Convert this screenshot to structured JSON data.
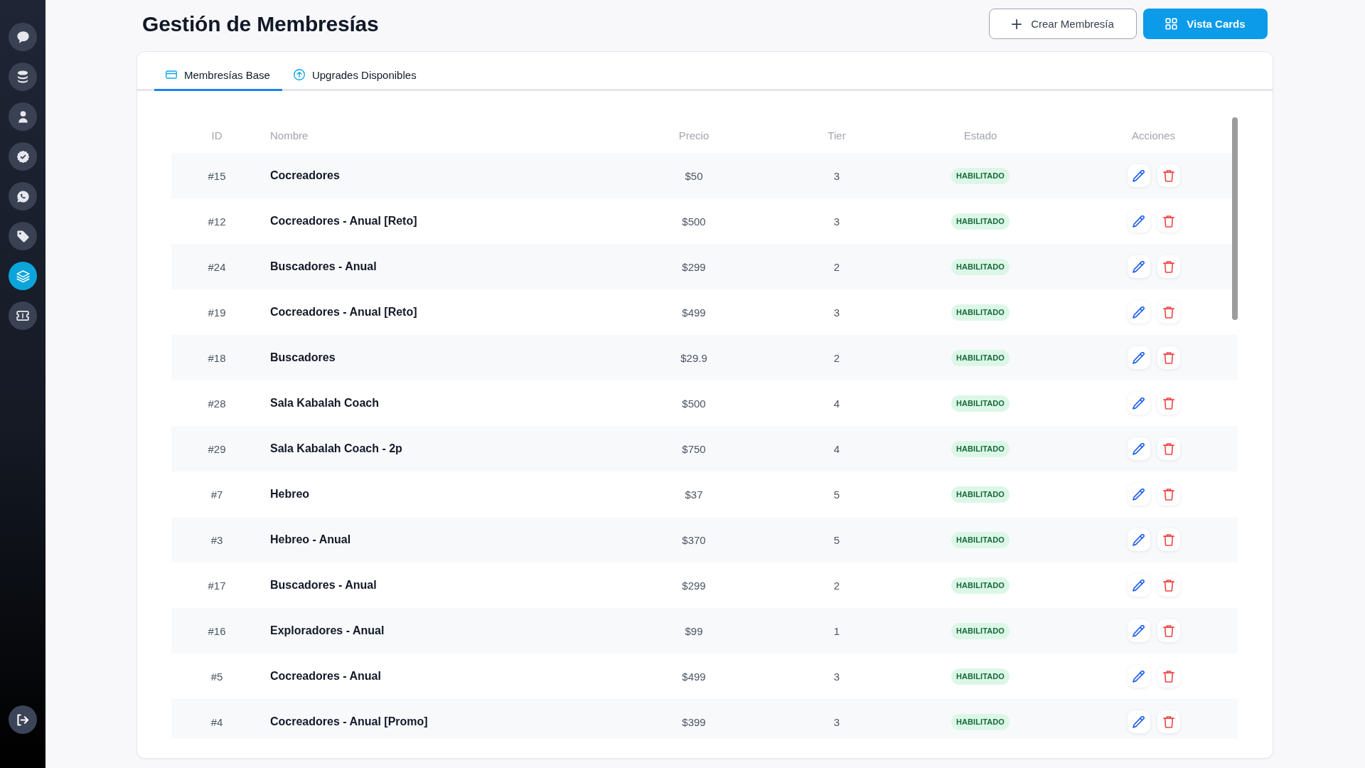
{
  "sidebar": {
    "items": [
      {
        "selected": false
      },
      {
        "selected": false
      },
      {
        "selected": false
      },
      {
        "selected": false
      },
      {
        "selected": false
      },
      {
        "selected": false
      },
      {
        "selected": true
      },
      {
        "selected": false
      }
    ]
  },
  "header": {
    "title": "Gestión de Membresías",
    "buttons": [
      {
        "label": "Crear Membresía",
        "kind": "outline"
      },
      {
        "label": "Vista Cards",
        "kind": "primary"
      }
    ]
  },
  "tabs": [
    {
      "label": "Membresías Base",
      "selected": true
    },
    {
      "label": "Upgrades Disponibles",
      "selected": false
    }
  ],
  "table": {
    "columns": [
      "ID",
      "Nombre",
      "Precio",
      "Tier",
      "Estado",
      "Acciones"
    ],
    "rows": [
      {
        "id": "#15",
        "name": "Cocreadores",
        "price": "$50",
        "tier": "3",
        "status": "HABILITADO"
      },
      {
        "id": "#12",
        "name": "Cocreadores - Anual [Reto]",
        "price": "$500",
        "tier": "3",
        "status": "HABILITADO"
      },
      {
        "id": "#24",
        "name": "Buscadores - Anual",
        "price": "$299",
        "tier": "2",
        "status": "HABILITADO"
      },
      {
        "id": "#19",
        "name": "Cocreadores - Anual [Reto]",
        "price": "$499",
        "tier": "3",
        "status": "HABILITADO"
      },
      {
        "id": "#18",
        "name": "Buscadores",
        "price": "$29.9",
        "tier": "2",
        "status": "HABILITADO"
      },
      {
        "id": "#28",
        "name": "Sala Kabalah Coach",
        "price": "$500",
        "tier": "4",
        "status": "HABILITADO"
      },
      {
        "id": "#29",
        "name": "Sala Kabalah Coach - 2p",
        "price": "$750",
        "tier": "4",
        "status": "HABILITADO"
      },
      {
        "id": "#7",
        "name": "Hebreo",
        "price": "$37",
        "tier": "5",
        "status": "HABILITADO"
      },
      {
        "id": "#3",
        "name": "Hebreo - Anual",
        "price": "$370",
        "tier": "5",
        "status": "HABILITADO"
      },
      {
        "id": "#17",
        "name": "Buscadores - Anual",
        "price": "$299",
        "tier": "2",
        "status": "HABILITADO"
      },
      {
        "id": "#16",
        "name": "Exploradores - Anual",
        "price": "$99",
        "tier": "1",
        "status": "HABILITADO"
      },
      {
        "id": "#5",
        "name": "Cocreadores - Anual",
        "price": "$499",
        "tier": "3",
        "status": "HABILITADO"
      },
      {
        "id": "#4",
        "name": "Cocreadores - Anual [Promo]",
        "price": "$399",
        "tier": "3",
        "status": "HABILITADO"
      }
    ]
  }
}
